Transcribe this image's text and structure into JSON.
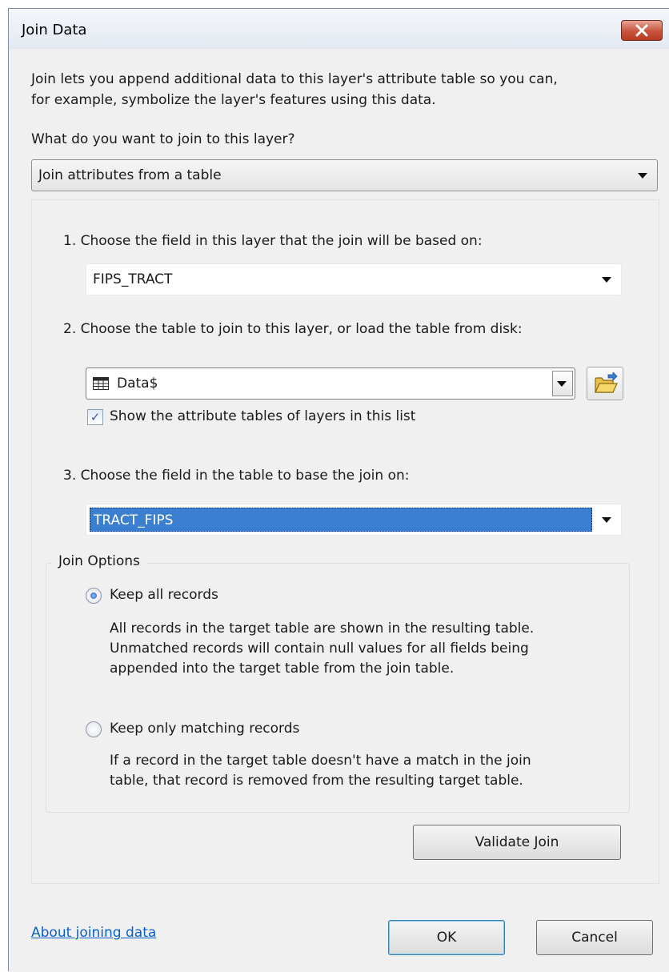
{
  "window": {
    "title": "Join Data",
    "close_label": "X"
  },
  "intro": {
    "line1": "Join lets you append additional data to this layer's attribute table so you can,",
    "line2": "for example, symbolize the layer's features using this data."
  },
  "join_type": {
    "question": "What do you want to join to this layer?",
    "selected": "Join attributes from a table"
  },
  "step1": {
    "label": "1.  Choose the field in this layer that the join will be based on:",
    "selected": "FIPS_TRACT"
  },
  "step2": {
    "label": "2.  Choose the table to join to this layer, or load the table from disk:",
    "selected": "Data$",
    "checkbox_label": "Show the attribute tables of layers in this list",
    "checkbox_checked": true
  },
  "step3": {
    "label": "3.  Choose the field in the table to base the join on:",
    "selected": "TRACT_FIPS"
  },
  "join_options": {
    "legend": "Join Options",
    "keep_all": {
      "label": "Keep all records",
      "selected": true,
      "desc1": "All records in the target table are shown in the resulting table.",
      "desc2": "Unmatched records will contain null values for all fields being",
      "desc3": "appended into the target table from the join table."
    },
    "keep_matching": {
      "label": "Keep only matching records",
      "selected": false,
      "desc1": "If a record in the target table doesn't have a match in the join",
      "desc2": "table, that record is removed from the resulting target table."
    }
  },
  "buttons": {
    "validate": "Validate Join",
    "ok": "OK",
    "cancel": "Cancel"
  },
  "footer": {
    "about_link": "About joining data"
  },
  "colors": {
    "selection_blue": "#3a7fd0",
    "close_red": "#c8533d",
    "link_blue": "#0b5fc9"
  }
}
